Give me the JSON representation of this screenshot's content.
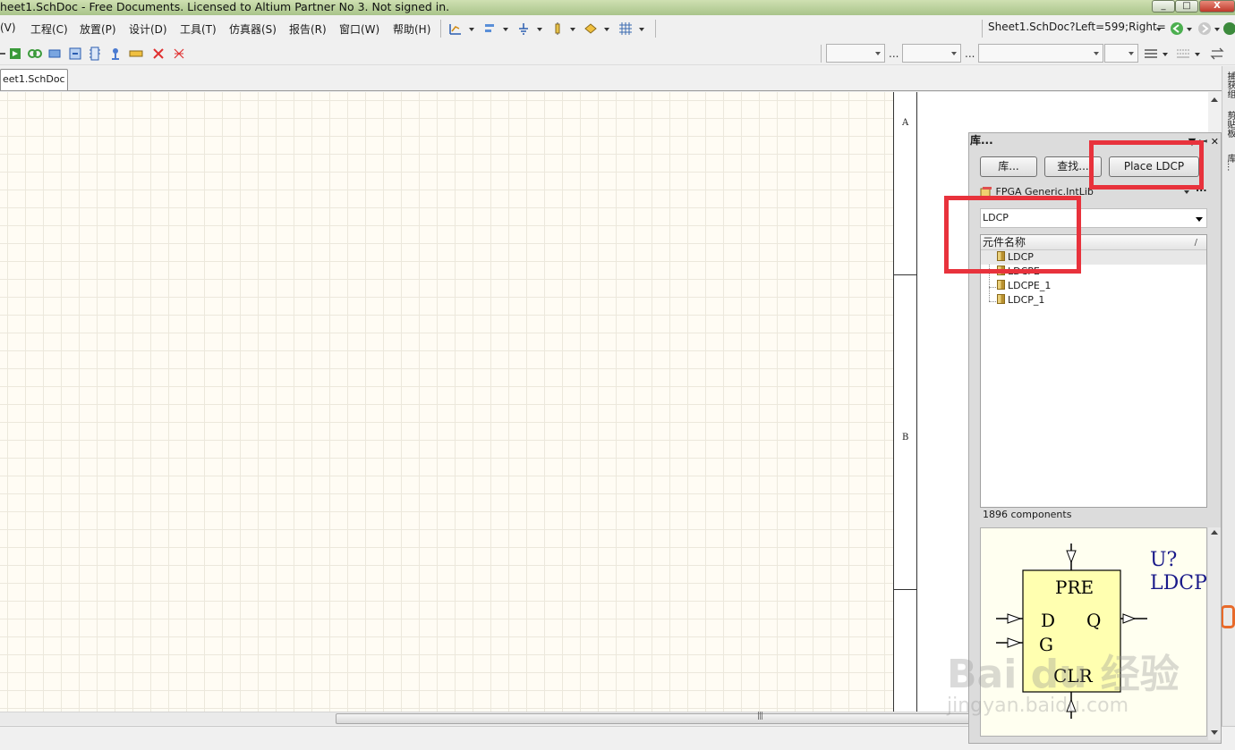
{
  "window": {
    "title": "heet1.SchDoc - Free Documents. Licensed to Altium Partner No 3. Not signed in.",
    "minimize": "_",
    "maximize": "□",
    "close": "X"
  },
  "menu": {
    "items": [
      {
        "label": "(V)"
      },
      {
        "label": "工程(C)"
      },
      {
        "label": "放置(P)"
      },
      {
        "label": "设计(D)"
      },
      {
        "label": "工具(T)"
      },
      {
        "label": "仿真器(S)"
      },
      {
        "label": "报告(R)"
      },
      {
        "label": "窗口(W)"
      },
      {
        "label": "帮助(H)"
      }
    ],
    "address": "Sheet1.SchDoc?Left=599;Right="
  },
  "toolbar2": {
    "ellipsis1": "...",
    "ellipsis2": "..."
  },
  "document_tab": {
    "label": "eet1.SchDoc"
  },
  "sheet_border": {
    "zone_a": "A",
    "zone_b": "B"
  },
  "right_dock": {
    "tabs": [
      "捕获组",
      "剪贴板",
      "库..."
    ]
  },
  "library_panel": {
    "title": "库...",
    "header_icons": "▼ ꟷ ✕",
    "buttons": {
      "libraries": "库...",
      "search": "查找...",
      "place": "Place LDCP"
    },
    "selected_library": "FPGA Generic.IntLib",
    "more": "...",
    "filter_value": "LDCP",
    "column_header": "元件名称",
    "sort_indicator": "/",
    "components": [
      "LDCP",
      "LDCPE",
      "LDCPE_1",
      "LDCP_1"
    ],
    "component_count": "1896 components",
    "preview": {
      "designator": "U?",
      "comment": "LDCP",
      "pin_pre": "PRE",
      "pin_d": "D",
      "pin_g": "G",
      "pin_q": "Q",
      "pin_clr": "CLR"
    }
  },
  "watermark": {
    "brand": "Bai du 经验",
    "url": "jingyan.baidu.com"
  },
  "colors": {
    "highlight": "#e8323c",
    "canvas": "#fffcf4",
    "preview_body": "#ffffb0"
  }
}
